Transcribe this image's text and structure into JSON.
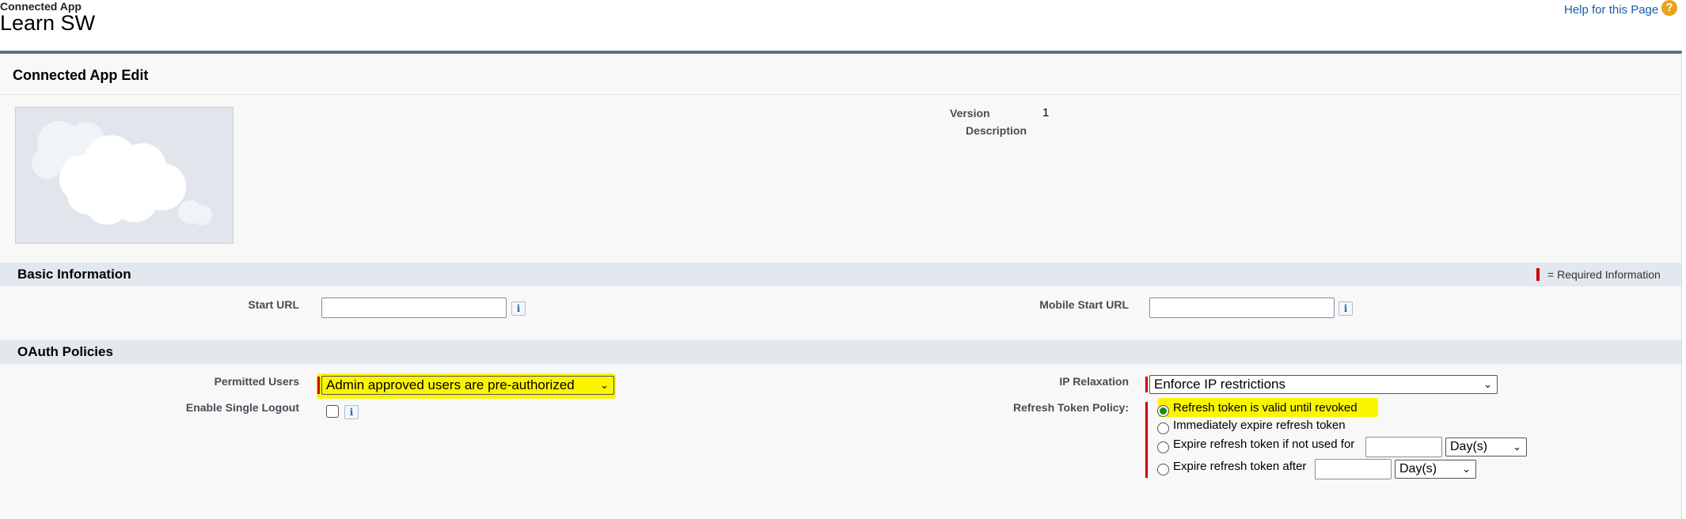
{
  "header": {
    "breadcrumb": "Connected App",
    "title": "Learn SW",
    "help_link": "Help for this Page",
    "help_icon": "question-circle-icon"
  },
  "panel": {
    "title": "Connected App Edit",
    "logo_icon": "cloud-logo-icon",
    "version_label": "Version",
    "version_value": "1",
    "description_label": "Description"
  },
  "basic_information": {
    "title": "Basic Information",
    "required_legend": "= Required Information",
    "start_url_label": "Start URL",
    "start_url_value": "",
    "mobile_start_url_label": "Mobile Start URL",
    "mobile_start_url_value": ""
  },
  "oauth_policies": {
    "title": "OAuth Policies",
    "permitted_users_label": "Permitted Users",
    "permitted_users_value": "Admin approved users are pre-authorized",
    "enable_single_logout_label": "Enable Single Logout",
    "enable_single_logout_checked": false,
    "ip_relaxation_label": "IP Relaxation",
    "ip_relaxation_value": "Enforce IP restrictions",
    "refresh_token_label": "Refresh Token Policy:",
    "refresh_options": [
      {
        "label": "Refresh token is valid until revoked",
        "checked": true
      },
      {
        "label": "Immediately expire refresh token",
        "checked": false
      },
      {
        "label": "Expire refresh token if not used for",
        "checked": false,
        "unit": "Day(s)"
      },
      {
        "label": "Expire refresh token after",
        "checked": false,
        "unit": "Day(s)"
      }
    ]
  },
  "colors": {
    "highlight": "#fbf500",
    "required": "#cc0000",
    "section_bar": "#e3e7ee",
    "panel_top_border": "#5b6f88"
  }
}
